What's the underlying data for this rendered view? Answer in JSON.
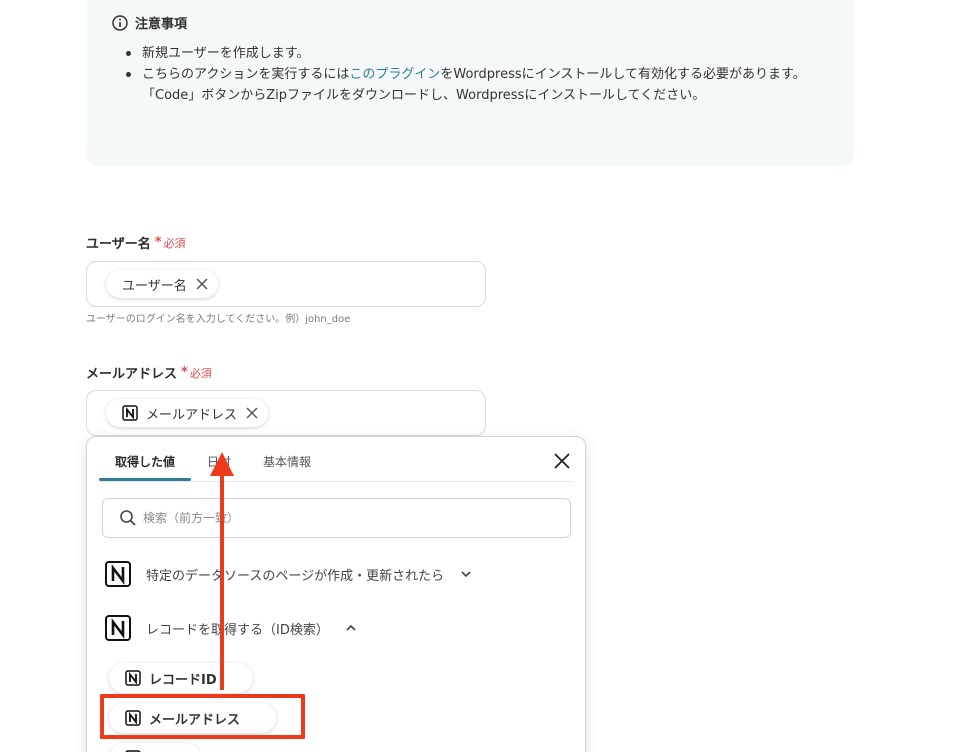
{
  "notice": {
    "title": "注意事項",
    "items": [
      "新規ユーザーを作成します。",
      "こちらのアクションを実行するには"
    ],
    "link_text": "このプラグイン",
    "item2_after": "をWordpressにインストールして有効化する必要があります。",
    "item2_cont": "「Code」ボタンからZipファイルをダウンロードし、Wordpressにインストールしてください。"
  },
  "username_field": {
    "label": "ユーザー名",
    "required": "必須",
    "chip": "ユーザー名",
    "help": "ユーザーのログイン名を入力してください。例）john_doe"
  },
  "email_field": {
    "label": "メールアドレス",
    "required": "必須",
    "chip": "メールアドレス"
  },
  "dropdown": {
    "tabs": [
      "取得した値",
      "日付",
      "基本情報"
    ],
    "active_tab": "取得した値",
    "search_placeholder": "検索（前方一致）",
    "groups": [
      {
        "label": "特定のデータソースのページが作成・更新されたら",
        "expanded": false
      },
      {
        "label": "レコードを取得する（ID検索）",
        "expanded": true
      }
    ],
    "items": [
      "レコードID",
      "メールアドレス"
    ]
  },
  "colors": {
    "accent": "#2f7e95",
    "required": "#e5484d",
    "annotation": "#ee3a1c"
  }
}
